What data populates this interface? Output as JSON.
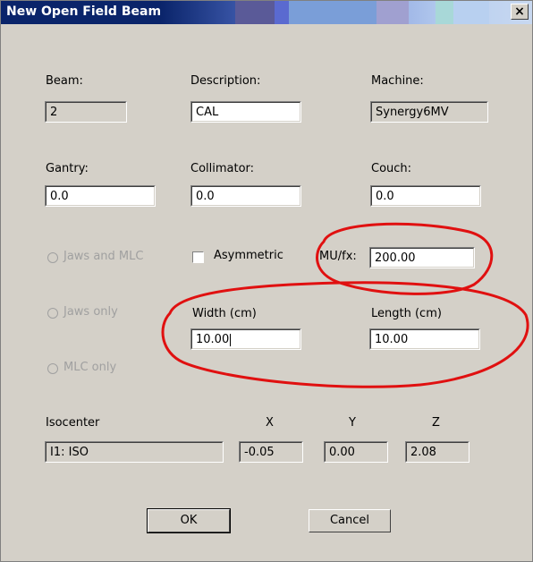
{
  "window": {
    "title": "New Open Field Beam",
    "close_glyph": "×"
  },
  "beam": {
    "label": "Beam:",
    "value": "2"
  },
  "description": {
    "label": "Description:",
    "value": "CAL"
  },
  "machine": {
    "label": "Machine:",
    "value": "Synergy6MV"
  },
  "gantry": {
    "label": "Gantry:",
    "value": "0.0"
  },
  "collimator": {
    "label": "Collimator:",
    "value": "0.0"
  },
  "couch": {
    "label": "Couch:",
    "value": "0.0"
  },
  "options": {
    "jaws_and_mlc": "Jaws and MLC",
    "jaws_only": "Jaws only",
    "mlc_only": "MLC only",
    "asymmetric": "Asymmetric"
  },
  "mu_fx": {
    "label": "MU/fx:",
    "value": "200.00"
  },
  "width": {
    "label": "Width (cm)",
    "value": "10.00"
  },
  "length": {
    "label": "Length (cm)",
    "value": "10.00"
  },
  "isocenter": {
    "label": "Isocenter",
    "value": "I1: ISO",
    "x_label": "X",
    "x_value": "-0.05",
    "y_label": "Y",
    "y_value": "0.00",
    "z_label": "Z",
    "z_value": "2.08"
  },
  "buttons": {
    "ok": "OK",
    "cancel": "Cancel"
  },
  "annotation_color": "#e01010"
}
